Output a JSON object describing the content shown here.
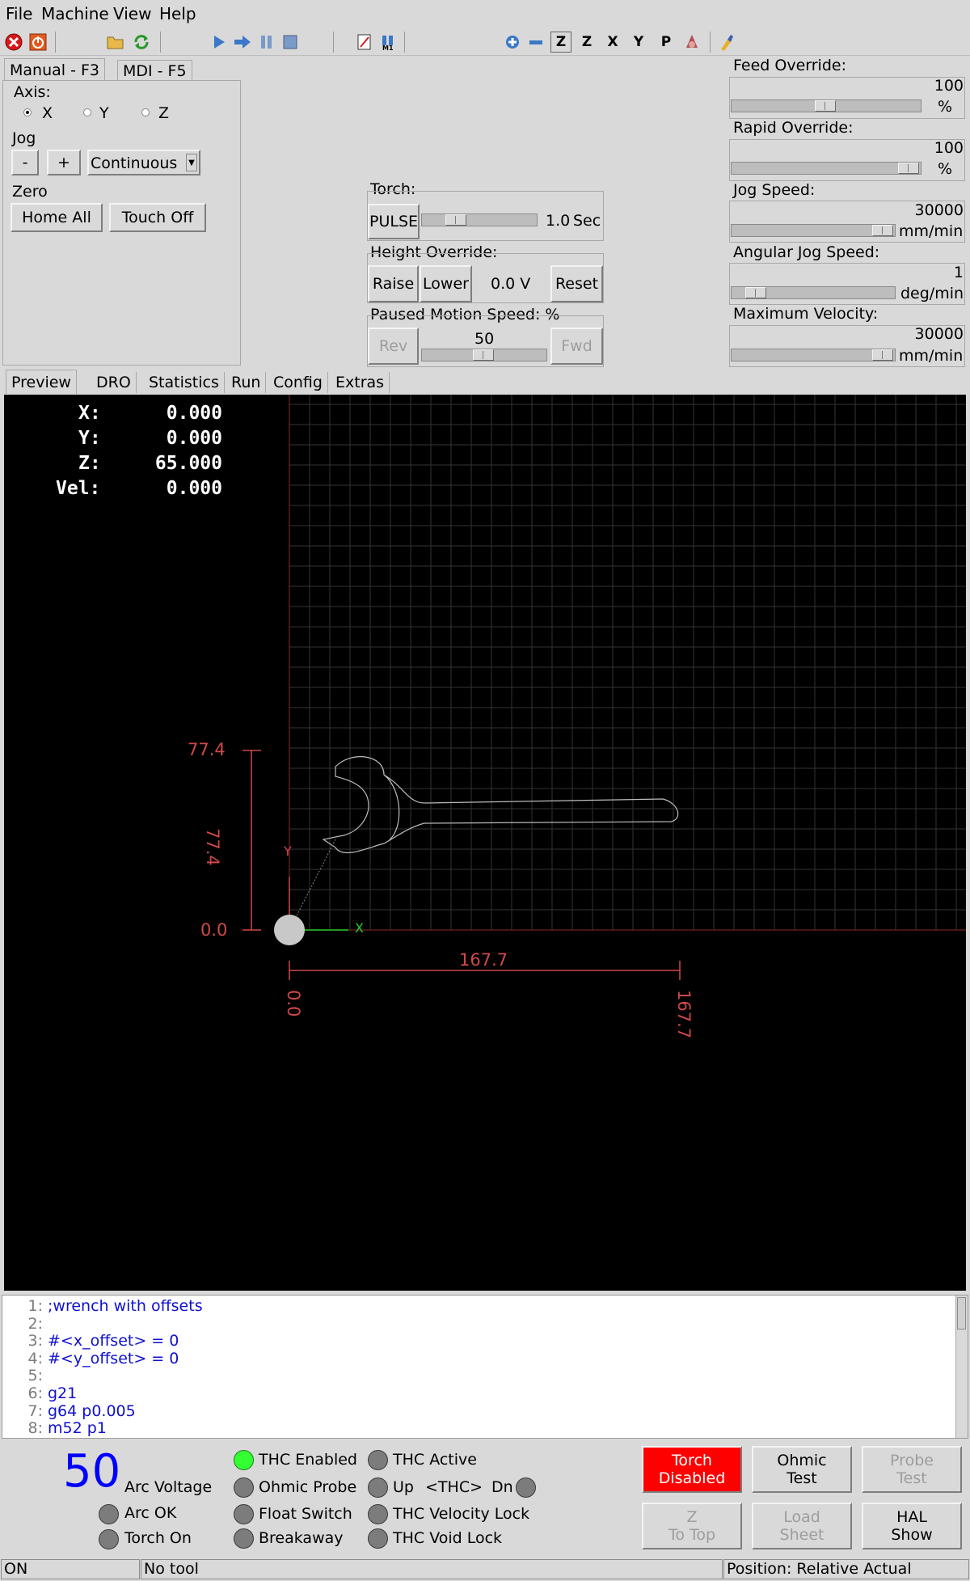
{
  "menu": {
    "file": "File",
    "machine": "Machine",
    "view": "View",
    "help": "Help"
  },
  "toolbar": {
    "icons": [
      "estop-icon",
      "power-icon",
      "open-icon",
      "reload-icon",
      "run-icon",
      "step-icon",
      "pause-icon",
      "stop-icon",
      "block-delete-icon",
      "optional-stop-icon",
      "zoom-in-icon",
      "zoom-out-icon",
      "view-z-icon",
      "view-z2-icon",
      "view-x-icon",
      "view-y-icon",
      "view-p-icon",
      "rotate-icon",
      "clear-plot-icon"
    ],
    "views": {
      "z": "Z",
      "z2": "Z",
      "x": "X",
      "y": "Y",
      "p": "P"
    }
  },
  "manual_tabs": [
    "Manual - F3",
    "MDI - F5"
  ],
  "manual": {
    "axis_label": "Axis:",
    "axes": [
      "X",
      "Y",
      "Z"
    ],
    "selected_axis": "X",
    "jog_label": "Jog",
    "jog_minus": "-",
    "jog_plus": "+",
    "jog_mode": "Continuous",
    "zero_label": "Zero",
    "home_all": "Home All",
    "touch_off": "Touch Off"
  },
  "torch": {
    "label": "Torch:",
    "pulse": "PULSE",
    "value": "1.0",
    "unit": "Sec",
    "slider_fraction": 0.25
  },
  "height_override": {
    "label": "Height Override:",
    "raise": "Raise",
    "lower": "Lower",
    "value": "0.0 V",
    "reset": "Reset"
  },
  "paused_motion": {
    "label": "Paused Motion Speed: %",
    "rev": "Rev",
    "value": "50",
    "fwd": "Fwd",
    "slider_fraction": 0.5
  },
  "overrides": {
    "feed": {
      "label": "Feed Override:",
      "value": "100",
      "unit": "%",
      "slider_fraction": 0.5
    },
    "rapid": {
      "label": "Rapid Override:",
      "value": "100",
      "unit": "%",
      "slider_fraction": 1.0
    },
    "jog_speed": {
      "label": "Jog Speed:",
      "value": "30000",
      "unit": "mm/min",
      "slider_fraction": 1.0
    },
    "angular_jog": {
      "label": "Angular Jog Speed:",
      "value": "1",
      "unit": "deg/min",
      "slider_fraction": 0.1
    },
    "max_velocity": {
      "label": "Maximum Velocity:",
      "value": "30000",
      "unit": "mm/min",
      "slider_fraction": 1.0
    }
  },
  "preview_tabs": [
    "Preview",
    "DRO",
    "Statistics",
    "Run",
    "Config",
    "Extras"
  ],
  "dro": [
    {
      "axis": "X:",
      "value": "0.000"
    },
    {
      "axis": "Y:",
      "value": "0.000"
    },
    {
      "axis": "Z:",
      "value": "65.000"
    },
    {
      "axis": "Vel:",
      "value": "0.000"
    }
  ],
  "plot": {
    "y_top": "77.4",
    "y_zero": "0.0",
    "y_dim": "77.4",
    "x_dim": "167.7",
    "x_zero": "0.0",
    "x_end": "167.7",
    "axis_x": "X",
    "axis_y": "Y"
  },
  "gcode": [
    {
      "n": "1:",
      "text": ";wrench with offsets"
    },
    {
      "n": "2:",
      "text": ""
    },
    {
      "n": "3:",
      "text": "#<x_offset> = 0"
    },
    {
      "n": "4:",
      "text": "#<y_offset> = 0"
    },
    {
      "n": "5:",
      "text": ""
    },
    {
      "n": "6:",
      "text": "g21"
    },
    {
      "n": "7:",
      "text": "g64 p0.005"
    },
    {
      "n": "8:",
      "text": "m52 p1"
    }
  ],
  "plasma": {
    "arc_voltage_value": "50",
    "arc_voltage_label": "Arc Voltage",
    "arc_ok": "Arc OK",
    "torch_on": "Torch On",
    "thc_enabled": "THC Enabled",
    "ohmic_probe": "Ohmic Probe",
    "float_switch": "Float Switch",
    "breakaway": "Breakaway",
    "thc_active": "THC Active",
    "up": "Up",
    "thc": "<THC>",
    "dn": "Dn",
    "thc_velocity_lock": "THC Velocity Lock",
    "thc_void_lock": "THC Void Lock"
  },
  "buttons": {
    "torch_line1": "Torch",
    "torch_line2": "Disabled",
    "ohmic_line1": "Ohmic",
    "ohmic_line2": "Test",
    "probe_line1": "Probe",
    "probe_line2": "Test",
    "z_line1": "Z",
    "z_line2": "To Top",
    "load_line1": "Load",
    "load_line2": "Sheet",
    "hal_line1": "HAL",
    "hal_line2": "Show"
  },
  "colors": {
    "torch_disabled": "#ff0000",
    "arc_voltage": "#0000ff",
    "plot_dim": "#d04848",
    "led_on": "#33ff33",
    "led_off": "#7c7c7c"
  },
  "statusbar": {
    "state": "ON",
    "tool": "No tool",
    "position": "Position: Relative Actual"
  }
}
